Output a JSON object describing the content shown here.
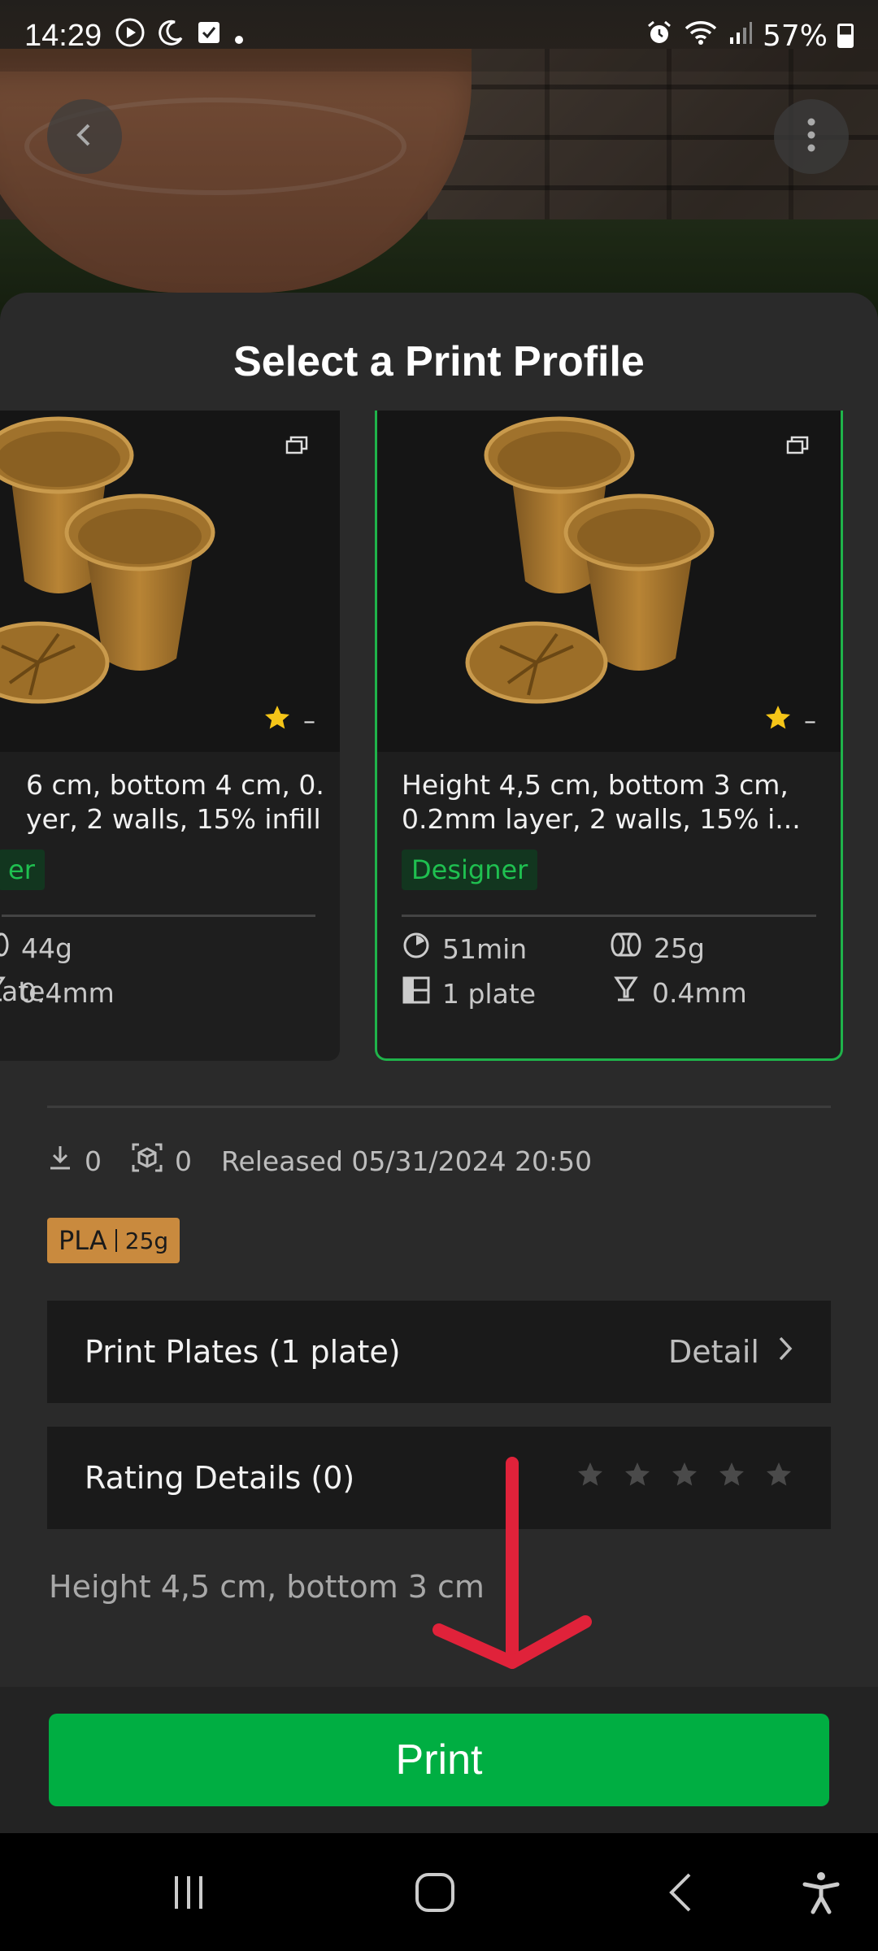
{
  "status_bar": {
    "time": "14:29",
    "battery": "57%",
    "icons_left": [
      "play-circle-icon",
      "moon-icon",
      "check-square-icon",
      "dot-icon"
    ],
    "icons_right": [
      "alarm-icon",
      "wifi-icon",
      "signal-icon",
      "battery-icon"
    ]
  },
  "sheet": {
    "title": "Select a Print Profile"
  },
  "profiles": [
    {
      "description": "6 cm, bottom 4 cm, 0.\nyer, 2 walls, 15% infill",
      "tag": "er",
      "rating": "–",
      "print_time": "",
      "weight": "44g",
      "plates": "ate",
      "nozzle": "0.4mm",
      "selected": false
    },
    {
      "description": "Height 4,5 cm, bottom 3 cm,\n0.2mm layer, 2 walls, 15% i...",
      "tag": "Designer",
      "rating": "–",
      "print_time": "51min",
      "weight": "25g",
      "plates": "1 plate",
      "nozzle": "0.4mm",
      "selected": true
    }
  ],
  "meta": {
    "downloads": "0",
    "prints": "0",
    "released": "Released 05/31/2024 20:50"
  },
  "filament": {
    "material": "PLA",
    "weight": "25g",
    "color": "#c98a3e"
  },
  "print_plates": {
    "label": "Print Plates (1 plate)",
    "action": "Detail"
  },
  "rating_details": {
    "label": "Rating Details (0)",
    "stars": 0
  },
  "description": "Height 4,5 cm, bottom 3 cm",
  "print_button": "Print",
  "colors": {
    "accent": "#00ae42",
    "selected_border": "#1fb34a",
    "tag_text": "#1fc050",
    "arrow": "#e0223a"
  }
}
